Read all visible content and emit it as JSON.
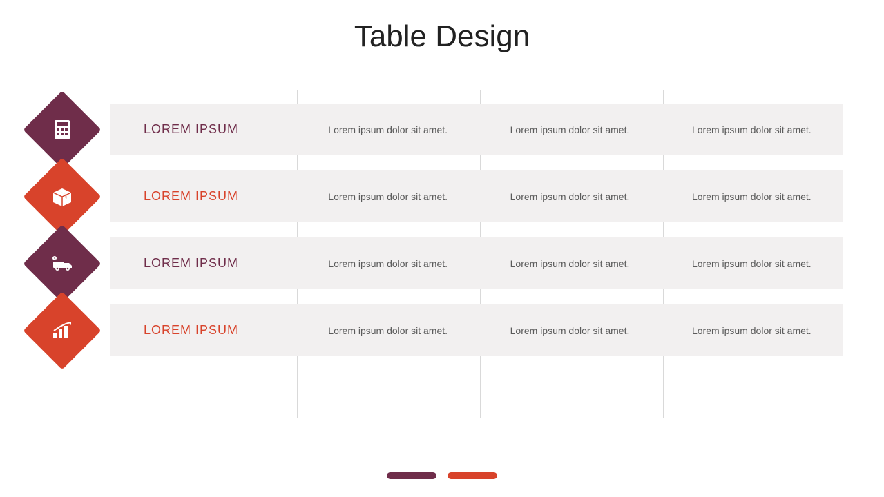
{
  "title": "Table Design",
  "colors": {
    "primary": "#6f2d4a",
    "secondary": "#d8432b",
    "rowBg": "#f2f0f0",
    "body": "#5b5b5b"
  },
  "rows": [
    {
      "icon": "calculator",
      "color": "a",
      "heading": "LOREM IPSUM",
      "cells": [
        "Lorem ipsum dolor sit amet.",
        "Lorem ipsum dolor sit amet.",
        "Lorem ipsum dolor sit amet."
      ]
    },
    {
      "icon": "box",
      "color": "b",
      "heading": "LOREM IPSUM",
      "cells": [
        "Lorem ipsum dolor sit amet.",
        "Lorem ipsum dolor sit amet.",
        "Lorem ipsum dolor sit amet."
      ]
    },
    {
      "icon": "delivery-truck",
      "color": "a",
      "heading": "LOREM IPSUM",
      "cells": [
        "Lorem ipsum dolor sit amet.",
        "Lorem ipsum dolor sit amet.",
        "Lorem ipsum dolor sit amet."
      ]
    },
    {
      "icon": "chart-growth",
      "color": "b",
      "heading": "LOREM IPSUM",
      "cells": [
        "Lorem ipsum dolor sit amet.",
        "Lorem ipsum dolor sit amet.",
        "Lorem ipsum dolor sit amet."
      ]
    }
  ]
}
